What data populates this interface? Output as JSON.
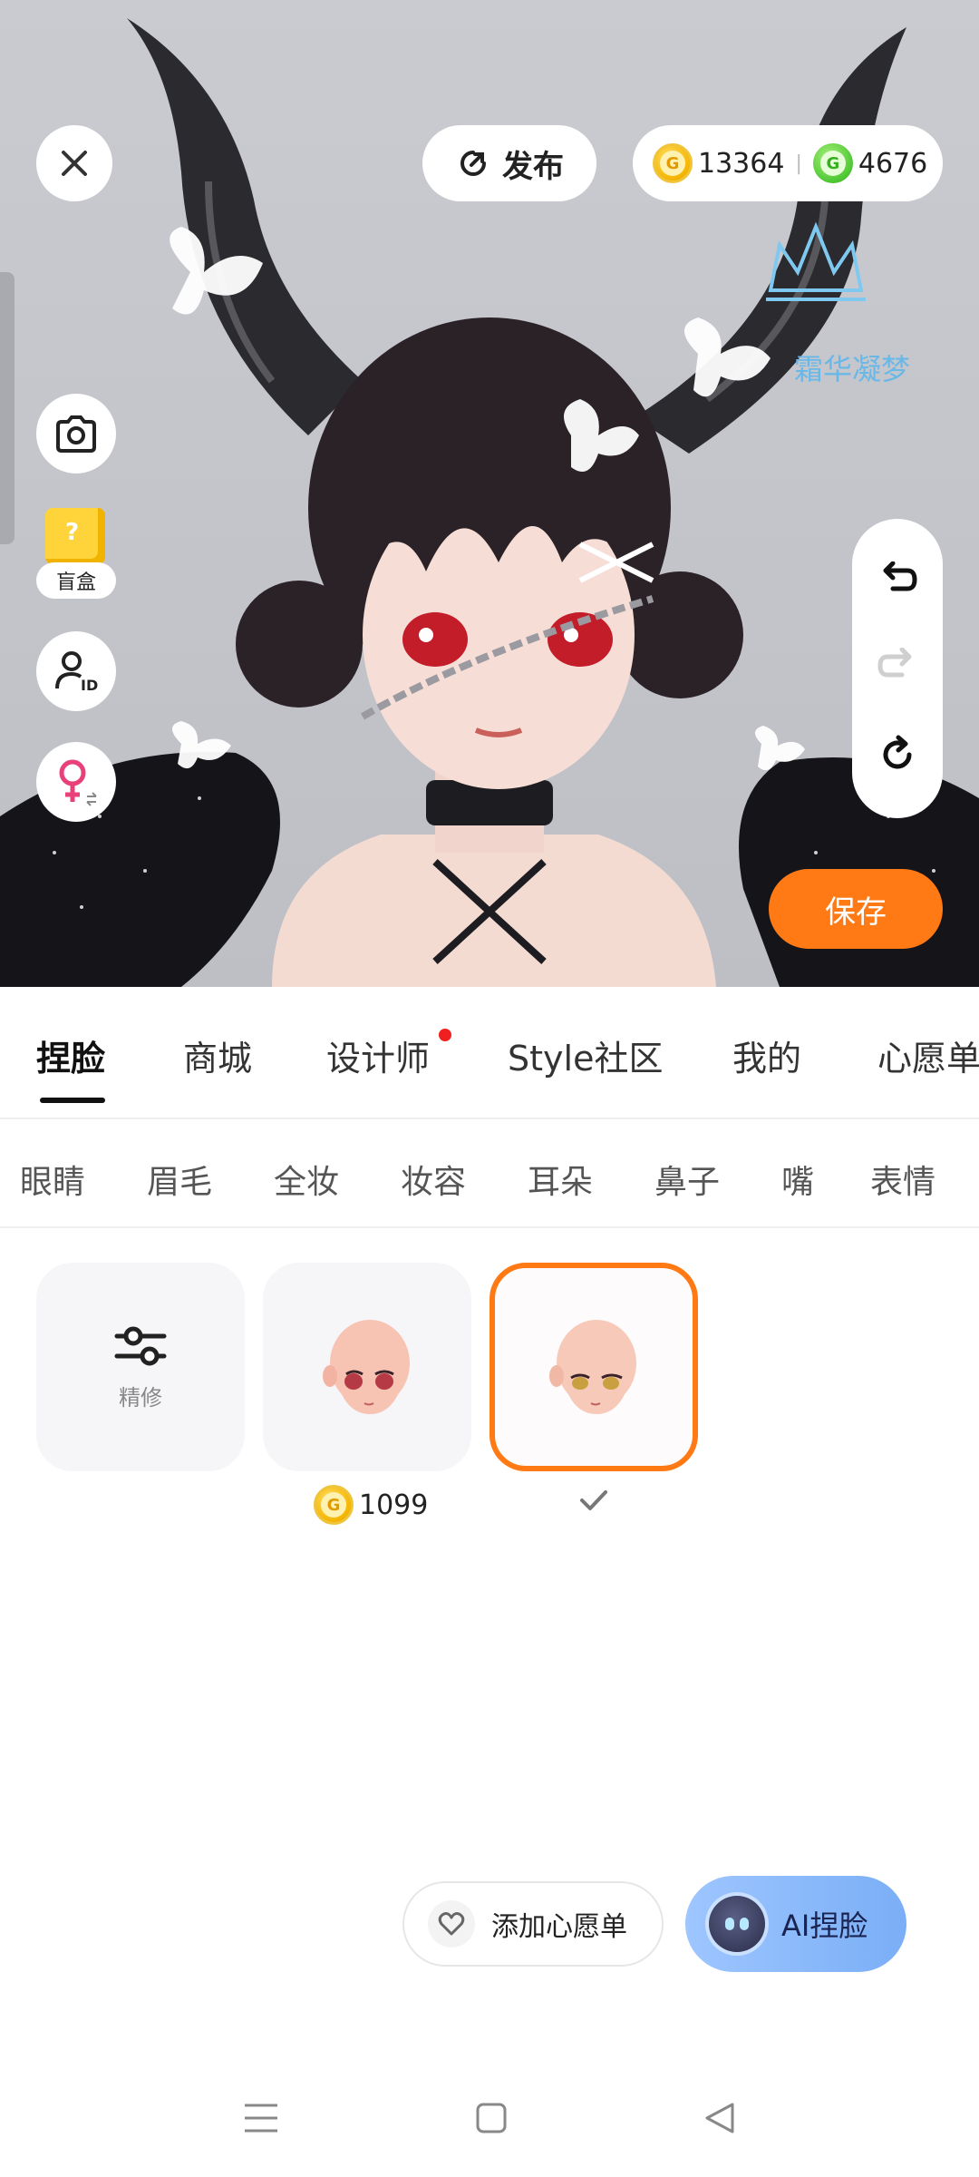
{
  "top_bar": {
    "publish_label": "发布",
    "gold_coins": "13364",
    "green_coins": "4676"
  },
  "watermark": "霜华凝梦",
  "left_tools": {
    "blind_box_label": "盲盒"
  },
  "save_label": "保存",
  "main_tabs": [
    {
      "label": "捏脸",
      "active": true
    },
    {
      "label": "商城"
    },
    {
      "label": "设计师",
      "badge": "red-dot"
    },
    {
      "label": "Style社区"
    },
    {
      "label": "我的"
    },
    {
      "label": "心愿单"
    }
  ],
  "sub_tabs": [
    "眼睛",
    "眉毛",
    "全妆",
    "妆容",
    "耳朵",
    "鼻子",
    "嘴",
    "表情"
  ],
  "items": {
    "refine_label": "精修",
    "item2_price": "1099",
    "selected_index": 2
  },
  "bottom_actions": {
    "wishlist_label": "添加心愿单",
    "ai_face_label": "AI捏脸"
  },
  "colors": {
    "accent_orange": "#ff7a14",
    "gold_coin": "#f5b400",
    "green_coin": "#4ec733",
    "ai_button": "#8db9fa"
  }
}
